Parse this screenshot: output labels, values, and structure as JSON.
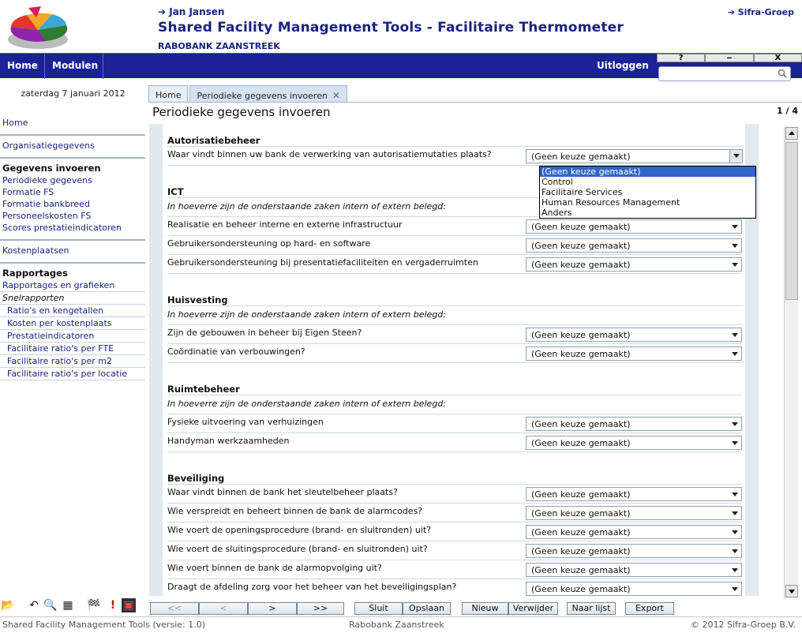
{
  "header": {
    "user_link": "➔ Jan Jansen",
    "app_title": "Shared Facility Management Tools - Facilitaire Thermometer",
    "org_name": "RABOBANK ZAANSTREEK",
    "brand_link": "➔ Sifra-Groep"
  },
  "topnav": {
    "home": "Home",
    "modules": "Modulen",
    "logout": "Uitloggen",
    "win_help": "?",
    "win_min": "‒",
    "win_close": "X",
    "search_value": ""
  },
  "date_text": "zaterdag 7 januari 2012",
  "tabs": [
    {
      "label": "Home"
    },
    {
      "label": "Periodieke gegevens invoeren",
      "close": "✕"
    }
  ],
  "sidebar": {
    "home": "Home",
    "org": "Organisatiegegevens",
    "input_head": "Gegevens invoeren",
    "input_items": [
      "Periodieke gegevens",
      "Formatie FS",
      "Formatie bankbreed",
      "Personeelskosten FS",
      "Scores prestatieindicatoren"
    ],
    "costcenters": "Kostenplaatsen",
    "reports_head": "Rapportages",
    "reports_item": "Rapportages en grafieken",
    "quick_head": "Snelrapporten",
    "quick_items": [
      "Ratio's en kengetallen",
      "Kosten per kostenplaats",
      "Prestatieindicatoren",
      "Facilitaire ratio's per FTE",
      "Facilitaire ratio's per m2",
      "Facilitaire ratio's per locatie"
    ]
  },
  "main": {
    "title": "Periodieke gegevens invoeren",
    "page_count": "1 / 4",
    "select_default": "(Geen keuze gemaakt)",
    "intro": "In hoeverre zijn de onderstaande zaken intern of extern belegd:",
    "sections": {
      "auth": {
        "title": "Autorisatiebeheer",
        "questions": [
          "Waar vindt binnen uw bank de verwerking van autorisatiemutaties plaats?"
        ]
      },
      "ict": {
        "title": "ICT",
        "questions": [
          "Realisatie en beheer interne en externe infrastructuur",
          "Gebruikersondersteuning op hard- en software",
          "Gebruikersondersteuning bij presentatiefaciliteiten en vergaderruimten"
        ]
      },
      "housing": {
        "title": "Huisvesting",
        "questions": [
          "Zijn de gebouwen in beheer bij Eigen Steen?",
          "Coördinatie van verbouwingen?"
        ]
      },
      "space": {
        "title": "Ruimtebeheer",
        "questions": [
          "Fysieke uitvoering van verhuizingen",
          "Handyman werkzaamheden"
        ]
      },
      "security": {
        "title": "Beveiliging",
        "questions": [
          "Waar vindt binnen de bank het sleutelbeheer plaats?",
          "Wie verspreidt en beheert binnen de bank de alarmcodes?",
          "Wie voert de openingsprocedure (brand- en sluitronden) uit?",
          "Wie voert de sluitingsprocedure (brand- en sluitronden) uit?",
          "Wie voert binnen de bank de alarmopvolging uit?",
          "Draagt de afdeling zorg voor het beheer van het beveiligingsplan?"
        ]
      }
    },
    "dropdown_options": [
      "(Geen keuze gemaakt)",
      "Control",
      "Facilitaire Services",
      "Human Resources Management",
      "Anders"
    ]
  },
  "toolbar": {
    "first": "<<",
    "prev": "<",
    "next": ">",
    "last": ">>",
    "close": "Sluit",
    "save": "Opslaan",
    "new": "Nieuw",
    "delete": "Verwijder",
    "to_list": "Naar lijst",
    "export": "Export"
  },
  "status": {
    "left": "Shared Facility Management Tools (versie: 1.0)",
    "center": "Rabobank Zaanstreek",
    "right": "© 2012  Sifra-Groep B.V."
  },
  "colors": {
    "navbar": "#1a2296",
    "link": "#1a237e",
    "highlight": "#3166c6",
    "panel": "#e0e8f0"
  }
}
